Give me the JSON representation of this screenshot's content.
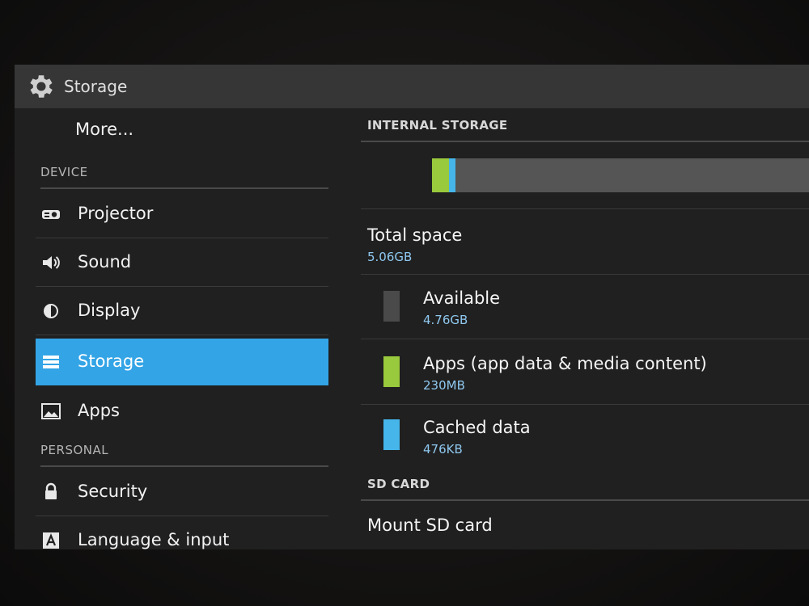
{
  "action_bar": {
    "title": "Storage",
    "icon": "gear-icon"
  },
  "nav": {
    "more_label": "More...",
    "device_header": "DEVICE",
    "personal_header": "PERSONAL",
    "items": [
      {
        "label": "Projector",
        "icon": "projector-icon"
      },
      {
        "label": "Sound",
        "icon": "speaker-icon"
      },
      {
        "label": "Display",
        "icon": "brightness-icon"
      },
      {
        "label": "Storage",
        "icon": "storage-icon",
        "selected": true
      },
      {
        "label": "Apps",
        "icon": "apps-icon"
      },
      {
        "label": "Security",
        "icon": "lock-icon"
      },
      {
        "label": "Language & input",
        "icon": "keyboard-letter-icon"
      }
    ],
    "selected_color": "#33a4e6"
  },
  "content": {
    "internal_header": "INTERNAL STORAGE",
    "usage_bar": {
      "apps_fraction": 0.045,
      "cached_fraction": 0.018,
      "colors": {
        "apps": "#99c93c",
        "cached": "#45b5ea",
        "available": "#555555"
      }
    },
    "total": {
      "label": "Total space",
      "value": "5.06GB"
    },
    "breakdown": [
      {
        "label": "Available",
        "value": "4.76GB",
        "color": "#4a4a4a"
      },
      {
        "label": "Apps (app data & media content)",
        "value": "230MB",
        "color": "#99c93c"
      },
      {
        "label": "Cached data",
        "value": "476KB",
        "color": "#45b5ea"
      }
    ],
    "sd_header": "SD CARD",
    "mount_label": "Mount SD card"
  }
}
